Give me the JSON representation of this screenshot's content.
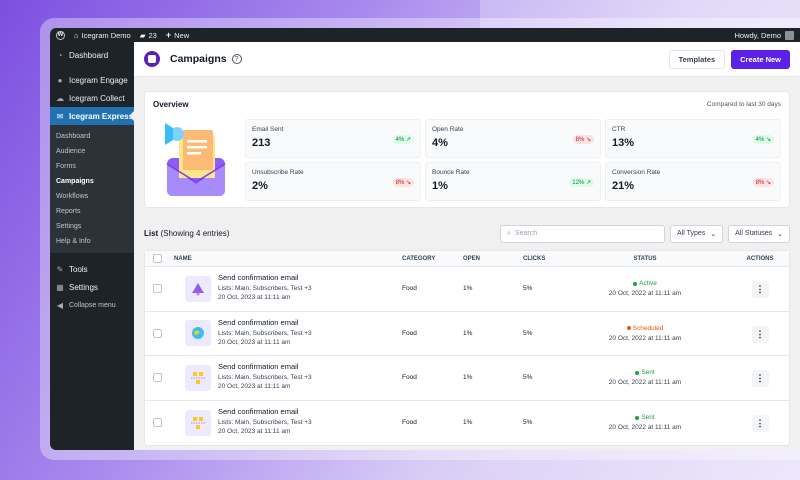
{
  "adminbar": {
    "site_name": "Icegram Demo",
    "comments_count": "23",
    "new_label": "New",
    "howdy": "Howdy, Demo"
  },
  "sidebar": {
    "top": [
      {
        "label": "Dashboard",
        "icon": "dashboard-icon"
      },
      {
        "label": "Icegram Engage",
        "icon": "engage-icon"
      },
      {
        "label": "Icegram Collect",
        "icon": "collect-icon"
      },
      {
        "label": "Icegram Express",
        "icon": "mail-icon"
      }
    ],
    "submenu": [
      "Dashboard",
      "Audience",
      "Forms",
      "Campaigns",
      "Workflows",
      "Reports",
      "Settings",
      "Help & Info"
    ],
    "bottom": [
      {
        "label": "Tools",
        "icon": "wrench-icon"
      },
      {
        "label": "Settings",
        "icon": "settings-icon"
      },
      {
        "label": "Collapse menu",
        "icon": "collapse-icon"
      }
    ]
  },
  "header": {
    "title": "Campaigns",
    "templates_label": "Templates",
    "create_label": "Create New"
  },
  "overview": {
    "title": "Overview",
    "compare": "Compared to last 30 days",
    "stats": [
      {
        "label": "Email Sent",
        "value": "213",
        "change": "4%",
        "trend": "up"
      },
      {
        "label": "Open Rate",
        "value": "4%",
        "change": "8%",
        "trend": "down"
      },
      {
        "label": "CTR",
        "value": "13%",
        "change": "4%",
        "trend": "up"
      },
      {
        "label": "Unsubscribe Rate",
        "value": "2%",
        "change": "8%",
        "trend": "down"
      },
      {
        "label": "Bounce Rate",
        "value": "1%",
        "change": "12%",
        "trend": "up"
      },
      {
        "label": "Conversion Rate",
        "value": "21%",
        "change": "8%",
        "trend": "down"
      }
    ]
  },
  "list": {
    "title": "List",
    "subtitle": "(Showing 4 entries)",
    "search_placeholder": "Search",
    "type_filter": "All Types",
    "status_filter": "All Statuses",
    "columns": {
      "name": "NAME",
      "category": "CATEGORY",
      "open": "OPEN",
      "clicks": "CLICKS",
      "status": "STATUS",
      "actions": "ACTIONS"
    },
    "rows": [
      {
        "name": "Send confirmation email",
        "lists": "Lists: Main, Subscribers, Test  +3",
        "date": "20 Oct, 2023 at 11:11 am",
        "category": "Food",
        "open": "1%",
        "clicks": "5%",
        "status": "Active",
        "status_color": "#16a34a",
        "status_date": "20 Oct, 2022 at 11:11 am",
        "thumb": "bell-icon"
      },
      {
        "name": "Send confirmation email",
        "lists": "Lists: Main, Subscribers, Test  +3",
        "date": "20 Oct, 2023 at 11:11 am",
        "category": "Food",
        "open": "1%",
        "clicks": "5%",
        "status": "Scheduled",
        "status_color": "#ea580c",
        "status_date": "20 Oct, 2022 at 11:11 am",
        "thumb": "globe-icon"
      },
      {
        "name": "Send confirmation email",
        "lists": "Lists: Main, Subscribers, Test  +3",
        "date": "20 Oct, 2023 at 11:11 am",
        "category": "Food",
        "open": "1%",
        "clicks": "5%",
        "status": "Sent",
        "status_color": "#16a34a",
        "status_date": "20 Oct, 2022 at 11:11 am",
        "thumb": "workflow-icon"
      },
      {
        "name": "Send confirmation email",
        "lists": "Lists: Main, Subscribers, Test  +3",
        "date": "20 Oct, 2023 at 11:11 am",
        "category": "Food",
        "open": "1%",
        "clicks": "5%",
        "status": "Sent",
        "status_color": "#16a34a",
        "status_date": "20 Oct, 2022 at 11:11 am",
        "thumb": "workflow-icon"
      }
    ]
  }
}
